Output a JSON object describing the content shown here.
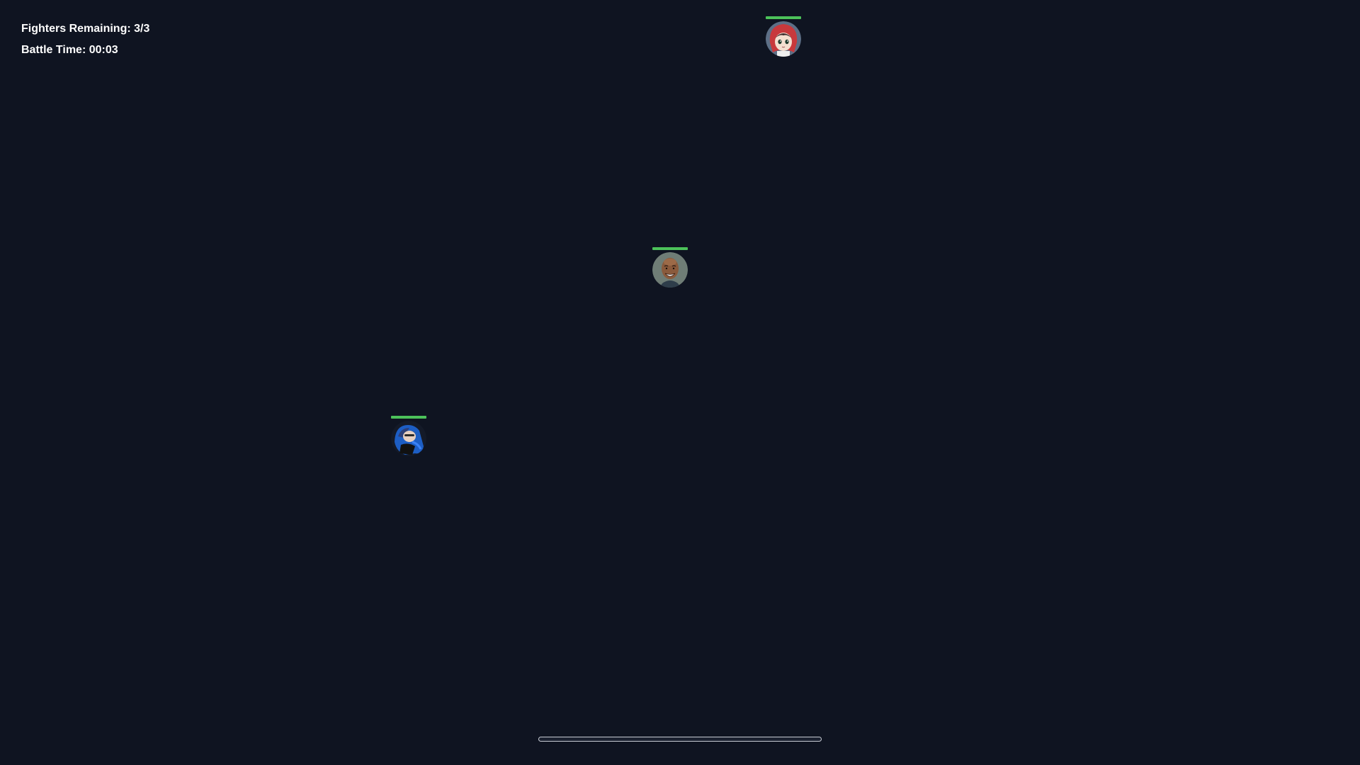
{
  "hud": {
    "fighters_remaining": "Fighters Remaining: 3/3",
    "battle_time": "Battle Time: 00:03"
  },
  "fighters": [
    {
      "avatar_icon": "red-hood-anime-girl-icon",
      "health": 1.0
    },
    {
      "avatar_icon": "smiling-bald-man-icon",
      "health": 1.0
    },
    {
      "avatar_icon": "blue-hooded-character-icon",
      "health": 1.0
    }
  ],
  "timeline": {
    "progress": 0.0
  },
  "colors": {
    "background": "#0f1421",
    "health": "#4cc25a",
    "hud_text": "#ffffff"
  }
}
